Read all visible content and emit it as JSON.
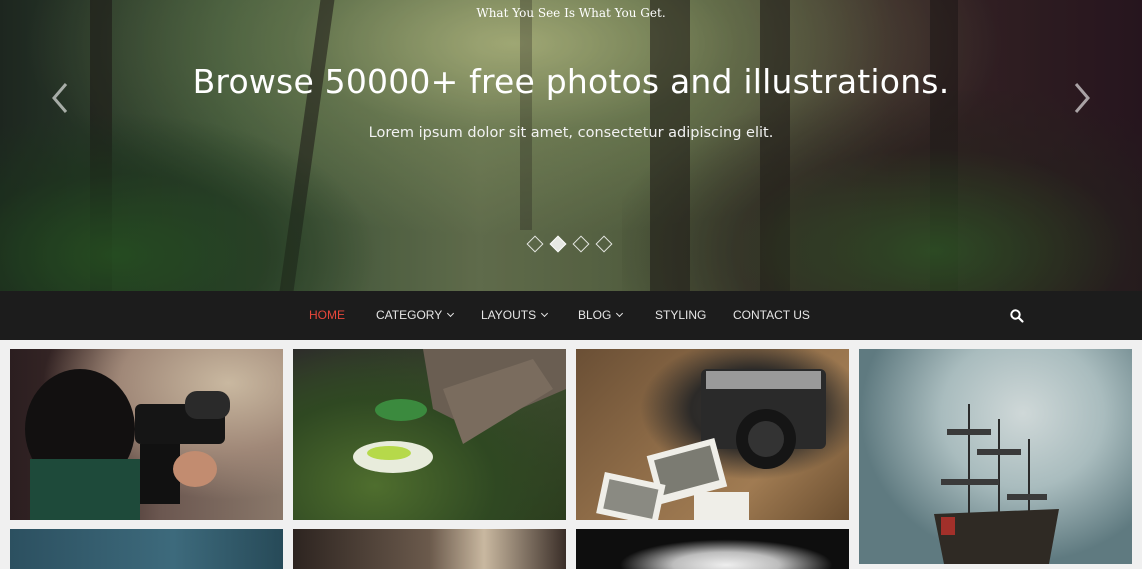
{
  "hero": {
    "tagline": "What You See Is What You Get.",
    "title": "Browse 50000+ free photos and illustrations.",
    "subtitle": "Lorem ipsum dolor sit amet, consectetur adipiscing elit.",
    "prev_icon": "chevron-left-icon",
    "next_icon": "chevron-right-icon",
    "slide_count": 4,
    "active_slide": 2
  },
  "nav": {
    "items": [
      {
        "label": "HOME",
        "active": true,
        "dropdown": false
      },
      {
        "label": "CATEGORY",
        "active": false,
        "dropdown": true
      },
      {
        "label": "LAYOUTS",
        "active": false,
        "dropdown": true
      },
      {
        "label": "BLOG",
        "active": false,
        "dropdown": true
      },
      {
        "label": "STYLING",
        "active": false,
        "dropdown": false
      },
      {
        "label": "CONTACT US",
        "active": false,
        "dropdown": false
      }
    ],
    "search_icon": "search-icon",
    "active_color": "#e8473b",
    "bg_color": "#1c1c1c"
  },
  "gallery": {
    "images": [
      {
        "subject": "photographer with video camera"
      },
      {
        "subject": "person in sneakers sitting on grass"
      },
      {
        "subject": "vintage camera with photos on map"
      },
      {
        "subject": "sailing ship under cloudy sky"
      },
      {
        "subject": "landscape partial"
      },
      {
        "subject": "sunset partial"
      },
      {
        "subject": "bird partial"
      }
    ]
  }
}
